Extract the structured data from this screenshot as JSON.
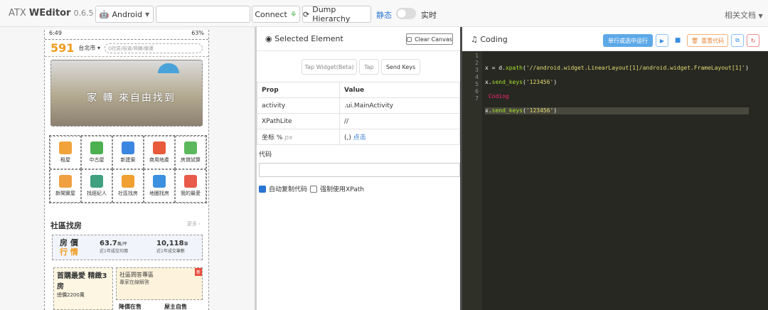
{
  "topbar": {
    "brand_prefix": "ATX ",
    "brand_bold": "WEditor",
    "version": "0.6.5",
    "platform": "Android",
    "connect": "Connect",
    "dump": "Dump Hierarchy",
    "static_label": "静态",
    "live_label": "实时",
    "docs": "相关文档"
  },
  "phone": {
    "time": "6:49",
    "battery": "63%",
    "logo": "591",
    "city": "台北市",
    "search_placeholder": "Q社區/街道/商圈/捷運",
    "banner_text": "家 轉 來自由找到",
    "grid": [
      "租屋",
      "中古屋",
      "新建案",
      "商用地產",
      "房貸試算",
      "新聞實屋",
      "找經紀人",
      "社區找房",
      "地圖找房",
      "我的最愛"
    ],
    "grid_colors": [
      "#f2a33a",
      "#4cb050",
      "#3b86e0",
      "#e85a3c",
      "#5cb85c",
      "#f0a040",
      "#40a080",
      "#f0a030",
      "#3b90e0",
      "#e85a4a"
    ],
    "section_title": "社區找房",
    "more": "更多",
    "price_label_a": "房 價",
    "price_label_b": "行 情",
    "stat1_value": "63.7",
    "stat1_unit": "萬/坪",
    "stat1_note": "近1年成交均價",
    "stat2_value": "10,118",
    "stat2_unit": "筆",
    "stat2_note": "近1年成交筆數",
    "card_left_title": "首購最愛 精緻3房",
    "card_left_note": "總價2200萬",
    "card_right_title": "社區問答專區",
    "card_right_note": "專家在線解答",
    "badge": "新",
    "bottom1": "降價在售",
    "bottom2": "屋主自售"
  },
  "inspector": {
    "title": "Selected Element",
    "clear": "Clear Canvas",
    "tap_widget": "Tap Widget(Beta)",
    "tap": "Tap",
    "send_keys": "Send Keys",
    "col_prop": "Prop",
    "col_value": "Value",
    "rows": [
      {
        "prop": "activity",
        "value": ".ui.MainActivity"
      },
      {
        "prop": "XPathLite",
        "value": "//"
      }
    ],
    "coord_label": "坐标 %",
    "coord_px": "px",
    "coord_value": "(,)",
    "coord_click": "点击",
    "code_label": "代码",
    "auto_copy": "自动复制代码",
    "force_xpath": "强制使用XPath"
  },
  "coding": {
    "title": "Coding",
    "run_selected": "单行或选中运行",
    "reset": "重置代码",
    "line_numbers": [
      "1",
      "2",
      "3",
      "4",
      "5",
      "6",
      "7"
    ],
    "line2_a": "x = d.",
    "line2_fn": "xpath",
    "line2_str": "'//android.widget.LinearLayout[1]/android.widget.FrameLayout[1]'",
    "line3_a": "x.",
    "line3_fn": "send_keys",
    "line3_str": "'123456'",
    "line4": " Coding",
    "line5_a": "x.",
    "line5_fn": "send_keys",
    "line5_str": "'123456'"
  },
  "colors": {
    "accent": "#2f7bd1",
    "logo": "#f09a1a",
    "editor_bg": "#272822"
  }
}
